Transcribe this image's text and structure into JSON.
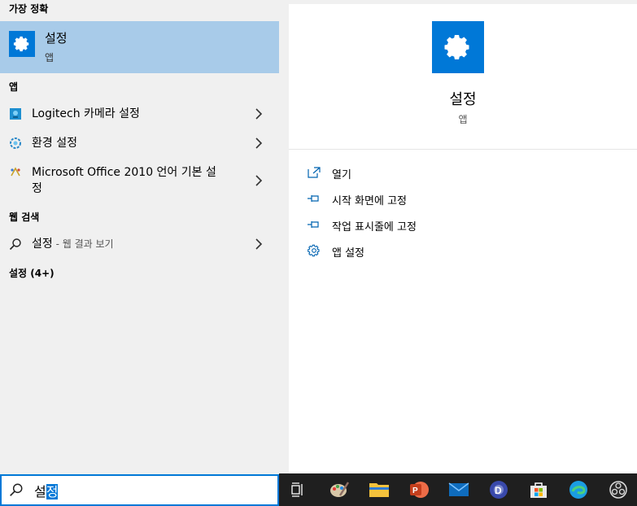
{
  "left": {
    "best_match_header": "가장 정확",
    "best_match": {
      "title": "설정",
      "subtitle": "앱"
    },
    "apps_header": "앱",
    "apps": [
      {
        "label": "Logitech 카메라 설정",
        "icon": "logitech-camera-icon"
      },
      {
        "label": "환경 설정",
        "icon": "gear-cog-icon"
      },
      {
        "label_line1": "Microsoft Office 2010 언어 기본 설",
        "label_line2": "정",
        "icon": "office-language-icon"
      }
    ],
    "web_header": "웹 검색",
    "web_item": {
      "label": "설정",
      "suffix": " - 웹 결과 보기",
      "icon": "search-icon"
    },
    "settings_header": "설정 (4+)"
  },
  "search": {
    "typed": "설",
    "selected": "정",
    "icon": "search-icon"
  },
  "right": {
    "title": "설정",
    "subtitle": "앱",
    "actions": [
      {
        "label": "열기",
        "icon": "open-icon"
      },
      {
        "label": "시작 화면에 고정",
        "icon": "pin-icon"
      },
      {
        "label": "작업 표시줄에 고정",
        "icon": "pin-icon"
      },
      {
        "label": "앱 설정",
        "icon": "gear-icon"
      }
    ]
  },
  "taskbar": {
    "icons": [
      "task-view-icon",
      "paint-app-icon",
      "file-explorer-icon",
      "powerpoint-icon",
      "mail-icon",
      "media-player-icon",
      "store-icon",
      "edge-icon",
      "obs-icon"
    ]
  },
  "colors": {
    "accent": "#0078d7",
    "highlight": "#a8cbe9",
    "taskbar": "#1f1f1f"
  }
}
